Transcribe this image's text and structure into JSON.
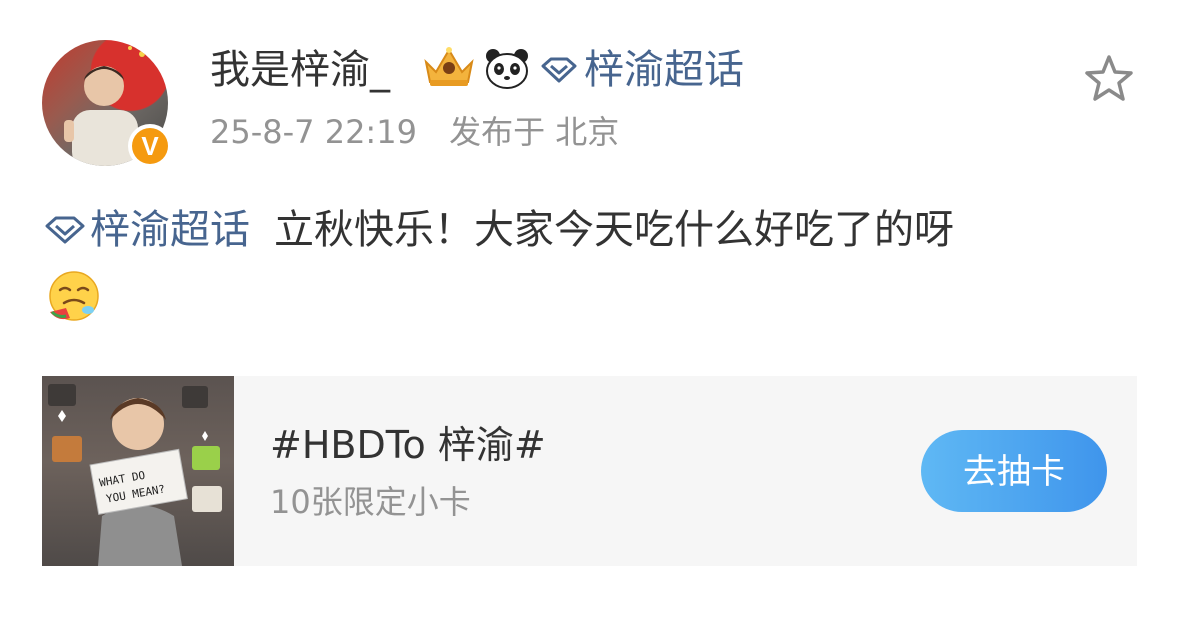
{
  "post": {
    "username": "我是梓渝_",
    "topic_label": "梓渝超话",
    "timestamp": "25-8-7 22:19",
    "location": "发布于 北京",
    "verified_badge": "V",
    "body_text": "立秋快乐！大家今天吃什么好吃了的呀",
    "icons": [
      "crown-icon",
      "panda-icon",
      "diamond-icon",
      "star-icon",
      "drool-emoji-icon"
    ]
  },
  "card": {
    "title": "#HBDTo 梓渝#",
    "subtitle": "10张限定小卡",
    "button_label": "去抽卡",
    "sign_text": "WHAT DO YOU MEAN?"
  },
  "colors": {
    "topic_blue": "#47658f",
    "text_dark": "#333333",
    "text_gray": "#939393",
    "card_bg": "#f6f6f6",
    "button_start": "#5fb8f4",
    "button_end": "#3f95ec",
    "badge_orange": "#f59a0f"
  }
}
